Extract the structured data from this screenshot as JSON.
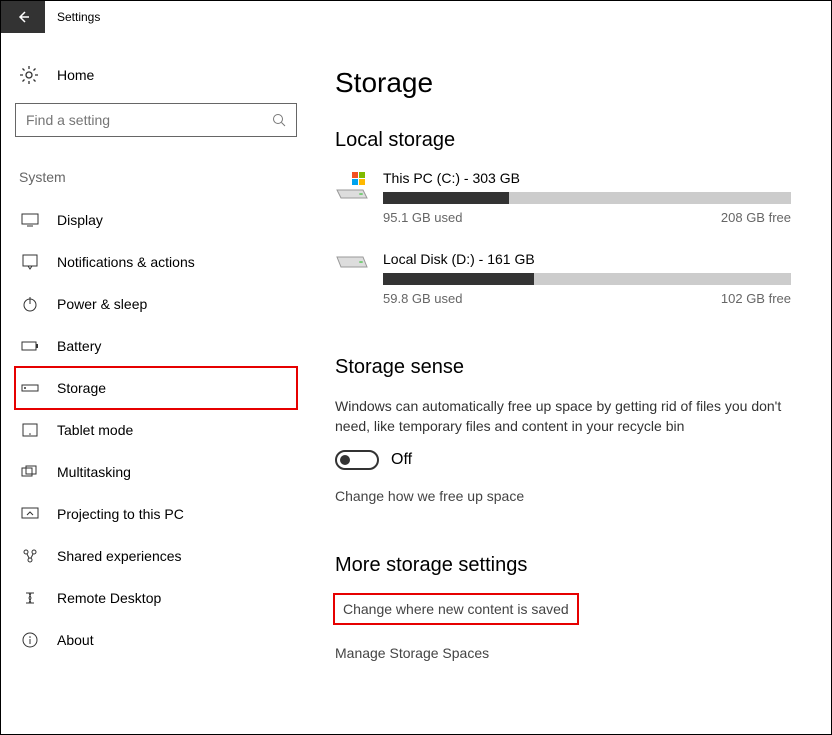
{
  "window": {
    "title": "Settings"
  },
  "sidebar": {
    "home": "Home",
    "search_placeholder": "Find a setting",
    "section": "System",
    "items": [
      {
        "label": "Display"
      },
      {
        "label": "Notifications & actions"
      },
      {
        "label": "Power & sleep"
      },
      {
        "label": "Battery"
      },
      {
        "label": "Storage"
      },
      {
        "label": "Tablet mode"
      },
      {
        "label": "Multitasking"
      },
      {
        "label": "Projecting to this PC"
      },
      {
        "label": "Shared experiences"
      },
      {
        "label": "Remote Desktop"
      },
      {
        "label": "About"
      }
    ]
  },
  "main": {
    "title": "Storage",
    "local_storage": {
      "heading": "Local storage",
      "drives": [
        {
          "name": "This PC (C:) - 303 GB",
          "used": "95.1 GB used",
          "free": "208 GB free",
          "fill_pct": 31,
          "has_winlogo": true
        },
        {
          "name": "Local Disk (D:) - 161 GB",
          "used": "59.8 GB used",
          "free": "102 GB free",
          "fill_pct": 37,
          "has_winlogo": false
        }
      ]
    },
    "sense": {
      "heading": "Storage sense",
      "desc": "Windows can automatically free up space by getting rid of files you don't need, like temporary files and content in your recycle bin",
      "toggle_label": "Off",
      "change_link": "Change how we free up space"
    },
    "more": {
      "heading": "More storage settings",
      "links": [
        "Change where new content is saved",
        "Manage Storage Spaces"
      ]
    }
  }
}
